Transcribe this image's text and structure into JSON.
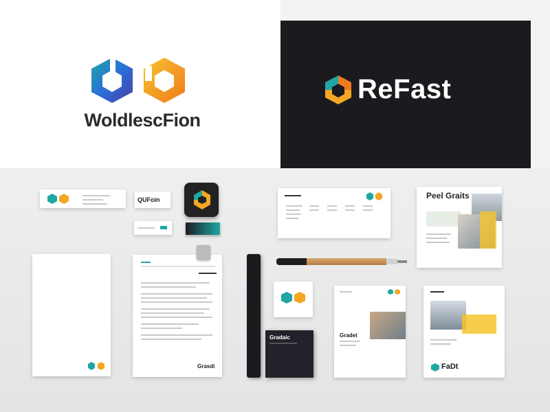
{
  "top_left": {
    "wordmark": "WoldlescFion"
  },
  "top_right": {
    "wordmark": "ReFast"
  },
  "stationery": {
    "business_card_small_label": "QUFoin",
    "report_heading": "Peel Graits",
    "brochure_title": "Gradet",
    "brochure_label": "FaDt",
    "notebook_heading": "Gradaic",
    "letterhead_footer": "Grasdi"
  },
  "colors": {
    "teal": "#1ea7a3",
    "blue": "#2a6fd6",
    "orange": "#f5a623",
    "yellow": "#f6c42d",
    "dark": "#1b1b1f"
  }
}
